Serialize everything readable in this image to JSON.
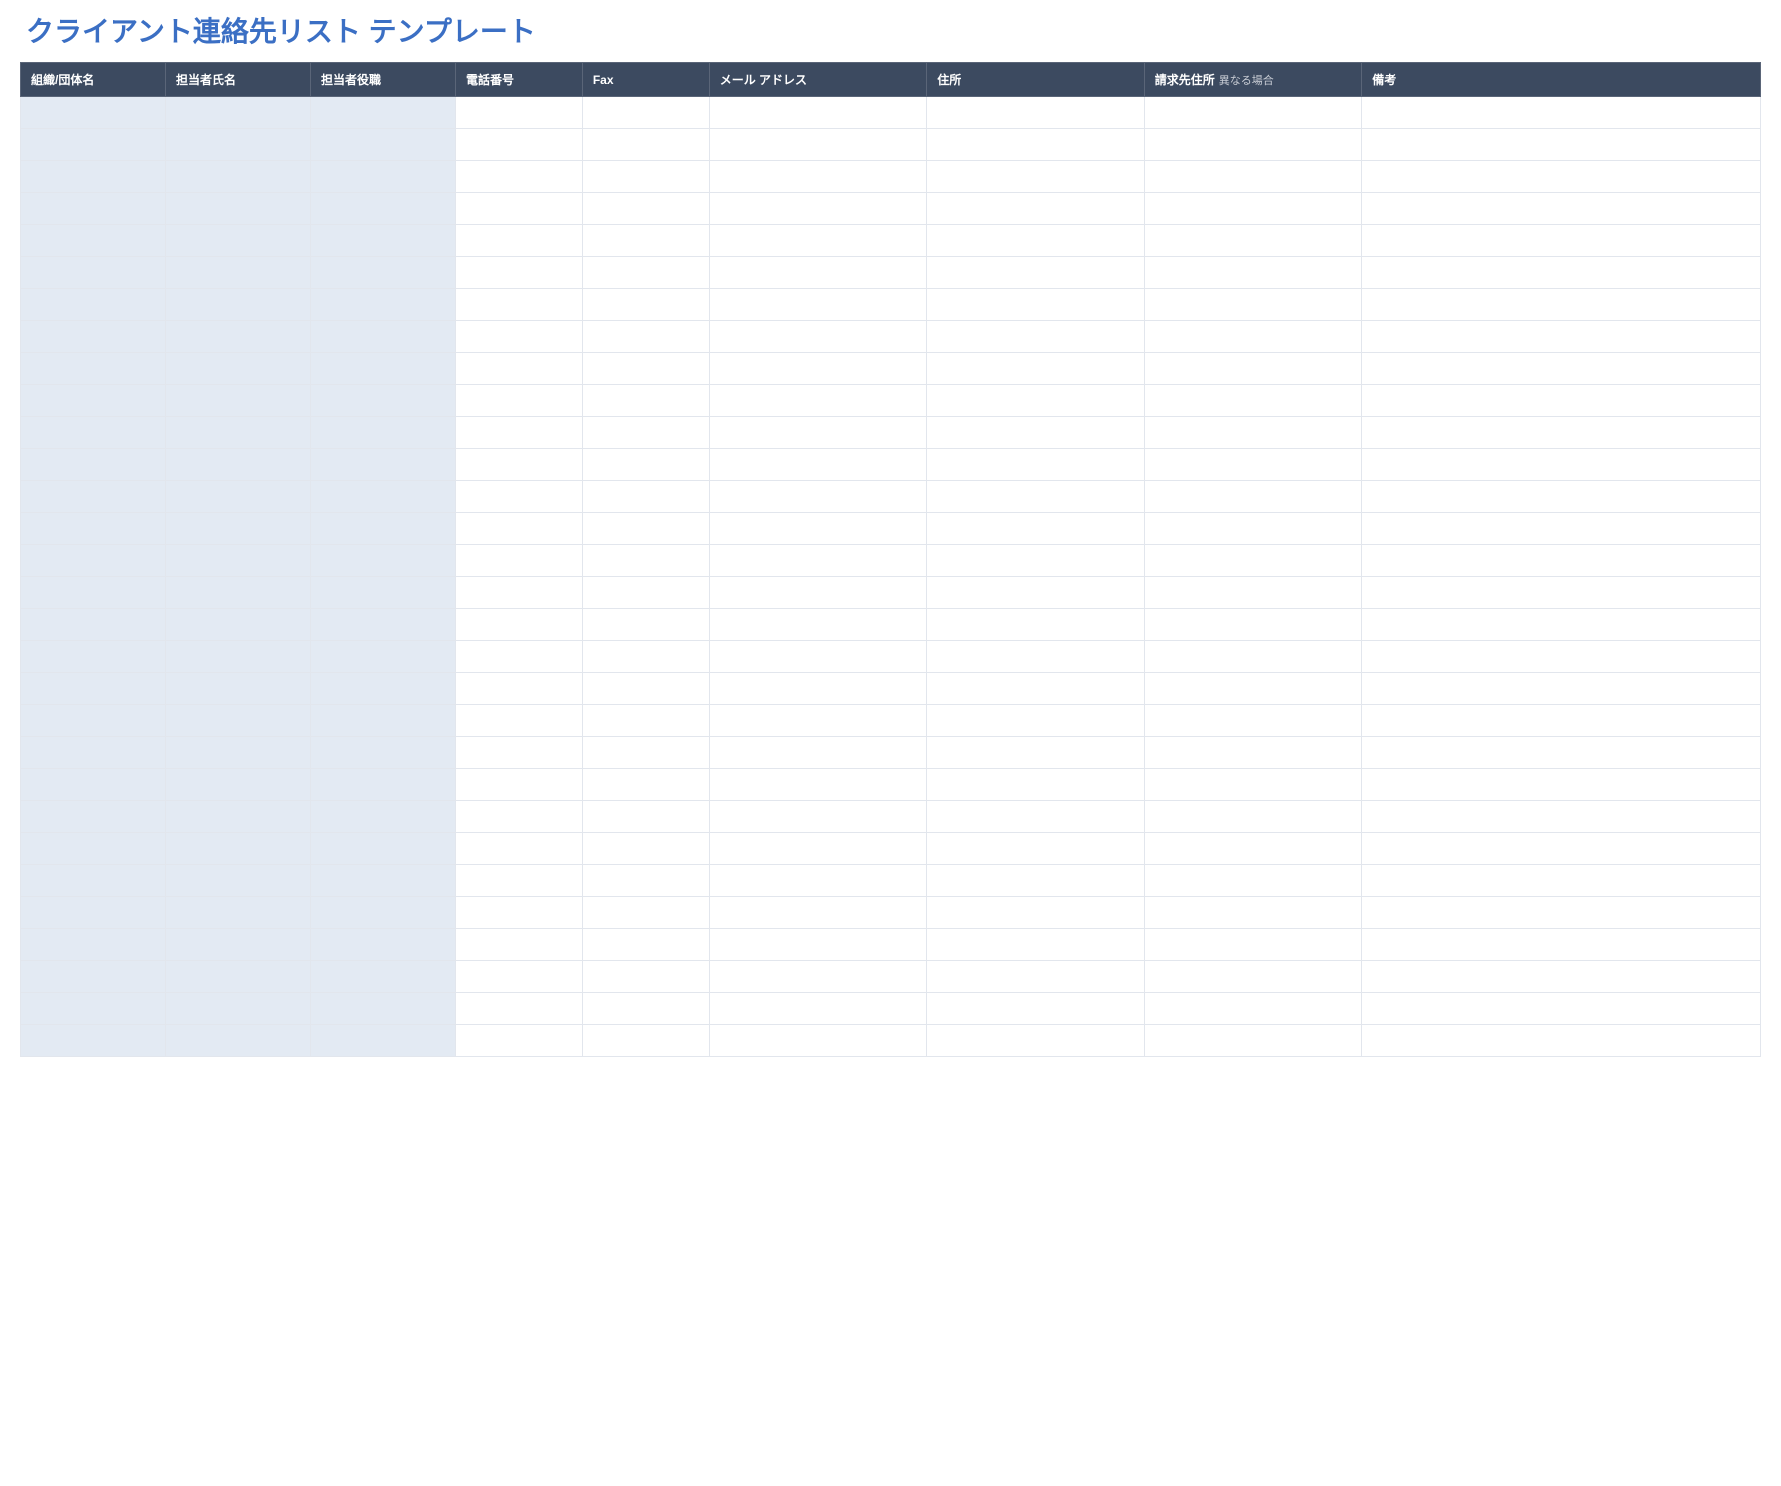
{
  "title": "クライアント連絡先リスト テンプレート",
  "columns": [
    {
      "label": "組織/団体名",
      "sub": "",
      "shaded": true
    },
    {
      "label": "担当者氏名",
      "sub": "",
      "shaded": true
    },
    {
      "label": "担当者役職",
      "sub": "",
      "shaded": true
    },
    {
      "label": "電話番号",
      "sub": "",
      "shaded": false
    },
    {
      "label": "Fax",
      "sub": "",
      "shaded": false
    },
    {
      "label": "メール アドレス",
      "sub": "",
      "shaded": false
    },
    {
      "label": "住所",
      "sub": "",
      "shaded": false
    },
    {
      "label": "請求先住所",
      "sub": "異なる場合",
      "shaded": false
    },
    {
      "label": "備考",
      "sub": "",
      "shaded": false
    }
  ],
  "row_count": 30,
  "colors": {
    "title": "#3b6fc4",
    "header_bg": "#3c4a60",
    "header_text": "#ffffff",
    "shaded_cell": "#e3eaf3",
    "plain_cell": "#ffffff",
    "border": "#e2e6ed"
  }
}
